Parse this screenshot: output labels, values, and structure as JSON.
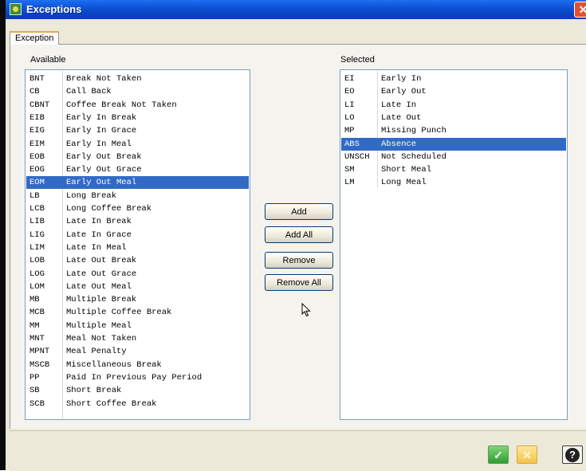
{
  "window": {
    "title": "Exceptions"
  },
  "tabs": [
    {
      "label": "Exception"
    }
  ],
  "available": {
    "label": "Available",
    "items": [
      {
        "code": "BNT",
        "desc": "Break Not Taken"
      },
      {
        "code": "CB",
        "desc": "Call Back"
      },
      {
        "code": "CBNT",
        "desc": "Coffee Break Not Taken"
      },
      {
        "code": "EIB",
        "desc": "Early In Break"
      },
      {
        "code": "EIG",
        "desc": "Early In Grace"
      },
      {
        "code": "EIM",
        "desc": "Early In Meal"
      },
      {
        "code": "EOB",
        "desc": "Early Out Break"
      },
      {
        "code": "EOG",
        "desc": "Early Out Grace"
      },
      {
        "code": "EOM",
        "desc": "Early Out Meal",
        "selected": true
      },
      {
        "code": "LB",
        "desc": "Long Break"
      },
      {
        "code": "LCB",
        "desc": "Long Coffee Break"
      },
      {
        "code": "LIB",
        "desc": "Late In Break"
      },
      {
        "code": "LIG",
        "desc": "Late In Grace"
      },
      {
        "code": "LIM",
        "desc": "Late In Meal"
      },
      {
        "code": "LOB",
        "desc": "Late Out Break"
      },
      {
        "code": "LOG",
        "desc": "Late Out Grace"
      },
      {
        "code": "LOM",
        "desc": "Late Out Meal"
      },
      {
        "code": "MB",
        "desc": "Multiple Break"
      },
      {
        "code": "MCB",
        "desc": "Multiple Coffee Break"
      },
      {
        "code": "MM",
        "desc": "Multiple Meal"
      },
      {
        "code": "MNT",
        "desc": "Meal Not Taken"
      },
      {
        "code": "MPNT",
        "desc": "Meal Penalty"
      },
      {
        "code": "MSCB",
        "desc": "Miscellaneous Break"
      },
      {
        "code": "PP",
        "desc": "Paid In Previous Pay Period"
      },
      {
        "code": "SB",
        "desc": "Short Break"
      },
      {
        "code": "SCB",
        "desc": "Short Coffee Break"
      }
    ]
  },
  "selected": {
    "label": "Selected",
    "items": [
      {
        "code": "EI",
        "desc": "Early In"
      },
      {
        "code": "EO",
        "desc": "Early Out"
      },
      {
        "code": "LI",
        "desc": "Late In"
      },
      {
        "code": "LO",
        "desc": "Late Out"
      },
      {
        "code": "MP",
        "desc": "Missing Punch"
      },
      {
        "code": "ABS",
        "desc": "Absence",
        "selected": true
      },
      {
        "code": "UNSCH",
        "desc": "Not Scheduled"
      },
      {
        "code": "SM",
        "desc": "Short Meal"
      },
      {
        "code": "LM",
        "desc": "Long Meal"
      }
    ]
  },
  "buttons": {
    "add": "Add",
    "add_all": "Add All",
    "remove": "Remove",
    "remove_all": "Remove All"
  },
  "footer": {
    "ok_icon": "checkmark-icon",
    "cancel_icon": "x-icon",
    "help_icon": "question-icon",
    "ok_symbol": "✓",
    "cancel_symbol": "✕",
    "help_symbol": "?"
  },
  "colors": {
    "selection": "#316ac5",
    "titlebar": "#0a43c3",
    "close": "#e5502c"
  }
}
